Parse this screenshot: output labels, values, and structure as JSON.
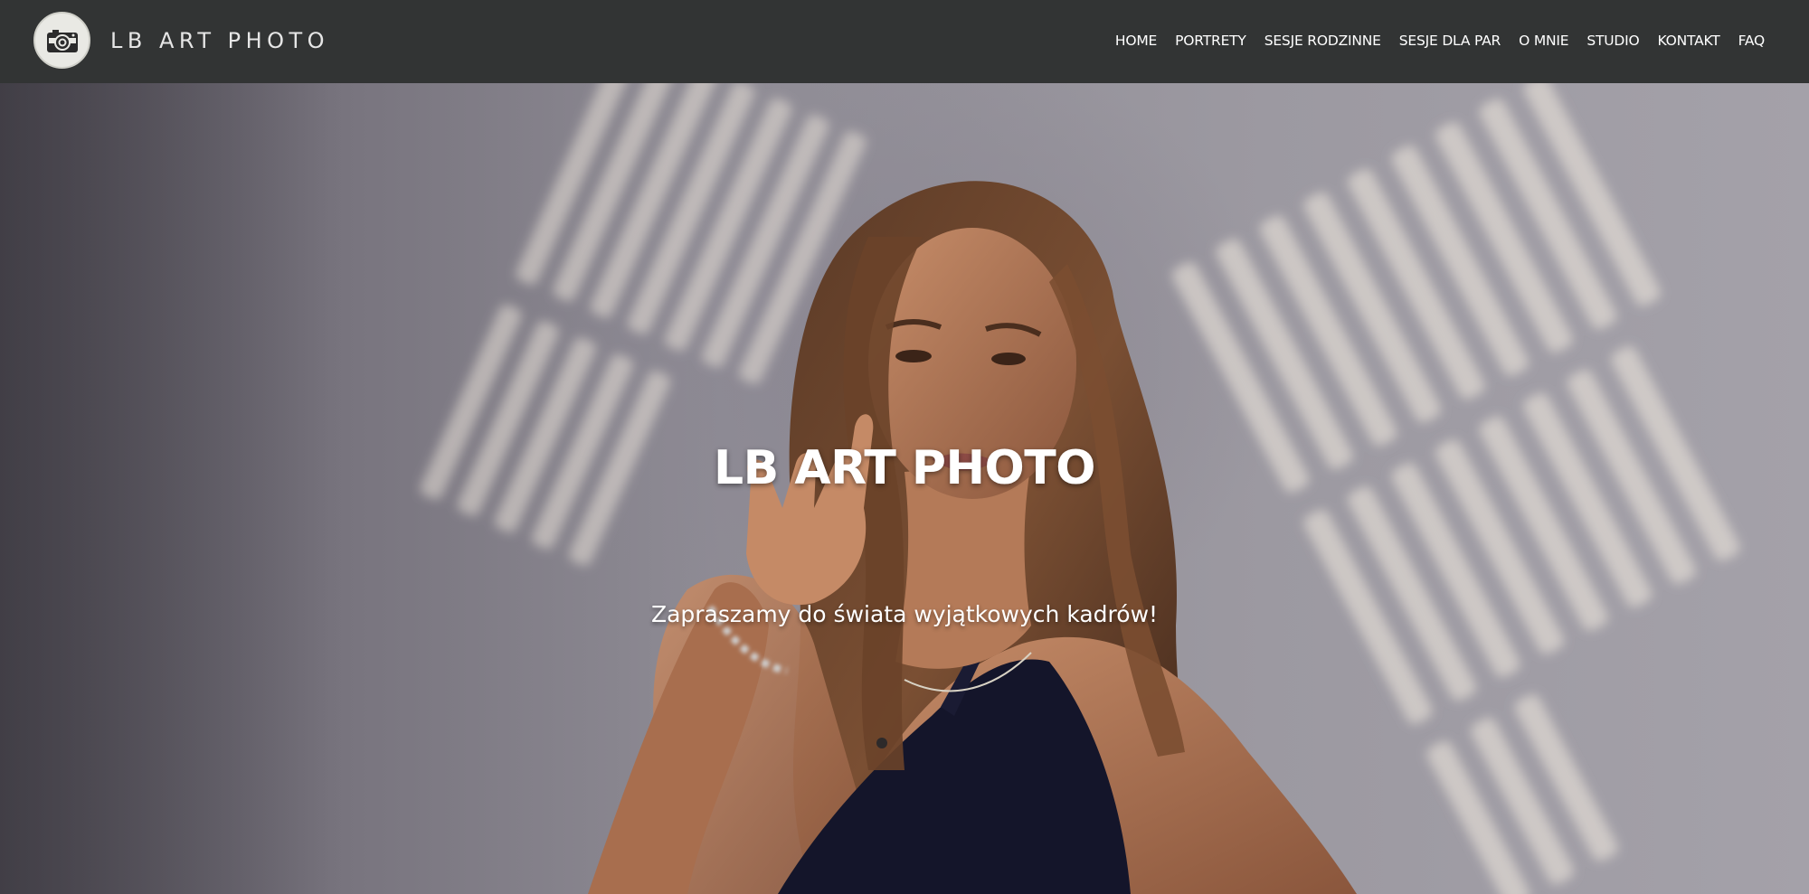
{
  "header": {
    "brand": "LB ART PHOTO",
    "logo_icon": "camera-icon",
    "nav": [
      {
        "label": "HOME"
      },
      {
        "label": "PORTRETY"
      },
      {
        "label": "SESJE RODZINNE"
      },
      {
        "label": "SESJE DLA PAR"
      },
      {
        "label": "O MNIE"
      },
      {
        "label": "STUDIO"
      },
      {
        "label": "KONTAKT"
      },
      {
        "label": "FAQ"
      }
    ]
  },
  "hero": {
    "title": "LB ART PHOTO",
    "subtitle": "Zapraszamy do świata wyjątkowych kadrów!"
  },
  "colors": {
    "header_bg": "#323434",
    "hero_bg": "#8f8c95",
    "text": "#ffffff"
  }
}
